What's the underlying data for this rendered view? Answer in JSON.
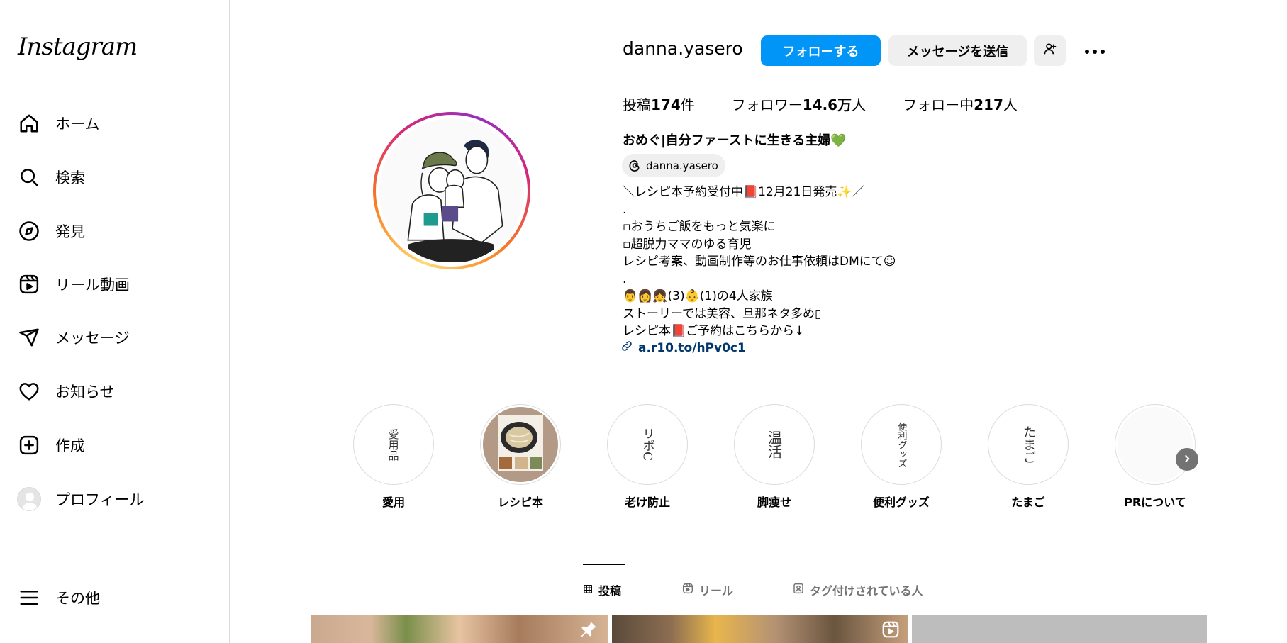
{
  "sidebar": {
    "logo": "Instagram",
    "items": [
      {
        "label": "ホーム",
        "icon": "home-icon"
      },
      {
        "label": "検索",
        "icon": "search-icon"
      },
      {
        "label": "発見",
        "icon": "compass-icon"
      },
      {
        "label": "リール動画",
        "icon": "reels-icon"
      },
      {
        "label": "メッセージ",
        "icon": "send-icon"
      },
      {
        "label": "お知らせ",
        "icon": "heart-icon"
      },
      {
        "label": "作成",
        "icon": "plus-square-icon"
      },
      {
        "label": "プロフィール",
        "icon": "avatar-icon"
      }
    ],
    "more": {
      "label": "その他",
      "icon": "menu-icon"
    }
  },
  "profile": {
    "username": "danna.yasero",
    "follow_label": "フォローする",
    "message_label": "メッセージを送信",
    "stats": {
      "posts_prefix": "投稿",
      "posts_value": "174",
      "posts_suffix": "件",
      "followers_prefix": "フォロワー",
      "followers_value": "14.6万",
      "followers_suffix": "人",
      "following_prefix": "フォロー中",
      "following_value": "217",
      "following_suffix": "人"
    },
    "display_name": "おめぐ|自分ファーストに生きる主婦💚",
    "threads_handle": "danna.yasero",
    "bio_lines": [
      "＼レシピ本予約受付中📕12月21日発売✨／",
      ".",
      "▫︎おうちご飯をもっと気楽に",
      "▫︎超脱力ママのゆる育児",
      "レシピ考案、動画制作等のお仕事依頼はDMにて☺",
      ".",
      "👨👩👧(3)👶(1)の4人家族",
      "ストーリーでは美容、旦那ネタ多め▯",
      "レシピ本📕ご予約はこちらから↓"
    ],
    "link": "a.r10.to/hPv0c1"
  },
  "highlights": [
    {
      "label": "愛用",
      "cover": "愛用品"
    },
    {
      "label": "レシピ本",
      "cover": ""
    },
    {
      "label": "老け防止",
      "cover": "リポC"
    },
    {
      "label": "脚痩せ",
      "cover": "温活"
    },
    {
      "label": "便利グッズ",
      "cover": "便利グッズ"
    },
    {
      "label": "たまご",
      "cover": "たまご"
    },
    {
      "label": "PRについて",
      "cover": ""
    }
  ],
  "tabs": [
    {
      "label": "投稿",
      "icon": "grid-icon",
      "active": true
    },
    {
      "label": "リール",
      "icon": "reels-icon",
      "active": false
    },
    {
      "label": "タグ付けされている人",
      "icon": "tagged-icon",
      "active": false
    }
  ],
  "colors": {
    "accent": "#0095f6",
    "link": "#00376b",
    "secondary_btn": "#efefef"
  }
}
